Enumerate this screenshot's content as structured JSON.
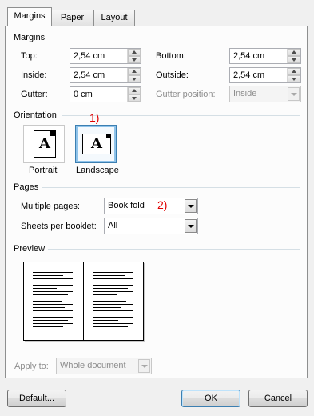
{
  "tabs": [
    {
      "label": "Margins",
      "active": true
    },
    {
      "label": "Paper",
      "active": false
    },
    {
      "label": "Layout",
      "active": false
    }
  ],
  "margins": {
    "group_label": "Margins",
    "top": {
      "label": "Top:",
      "value": "2,54 cm"
    },
    "bottom": {
      "label": "Bottom:",
      "value": "2,54 cm"
    },
    "inside": {
      "label": "Inside:",
      "value": "2,54 cm"
    },
    "outside": {
      "label": "Outside:",
      "value": "2,54 cm"
    },
    "gutter": {
      "label": "Gutter:",
      "value": "0 cm"
    },
    "gutter_position": {
      "label": "Gutter position:",
      "value": "Inside"
    }
  },
  "orientation": {
    "group_label": "Orientation",
    "portrait": "Portrait",
    "landscape": "Landscape",
    "page_glyph": "A",
    "selected": "landscape"
  },
  "pages": {
    "group_label": "Pages",
    "multiple_pages": {
      "label": "Multiple pages:",
      "value": "Book fold"
    },
    "sheets_per_booklet": {
      "label": "Sheets per booklet:",
      "value": "All"
    }
  },
  "preview": {
    "group_label": "Preview"
  },
  "apply_to": {
    "label": "Apply to:",
    "value": "Whole document"
  },
  "annotations": {
    "one": "1)",
    "two": "2)"
  },
  "colors": {
    "annotation": "#e00000",
    "selection": "#3c7fb1"
  },
  "buttons": {
    "default_label": "Default...",
    "ok_label": "OK",
    "cancel_label": "Cancel"
  }
}
